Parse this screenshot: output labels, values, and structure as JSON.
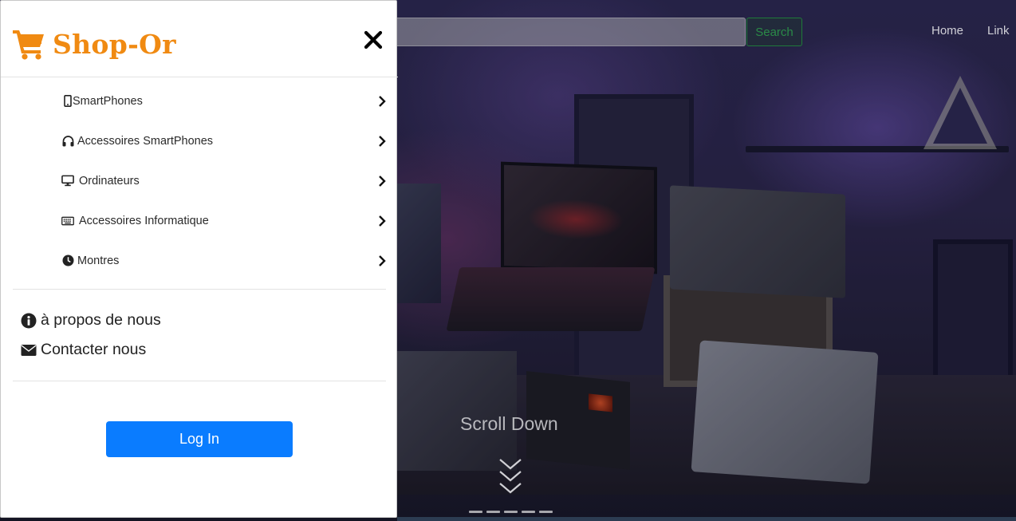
{
  "sidebar": {
    "brand": "Shop-Or",
    "categories": [
      {
        "label": "SmartPhones",
        "icon": "mobile-phone-icon"
      },
      {
        "label": "Accessoires SmartPhones",
        "icon": "headphones-icon"
      },
      {
        "label": "Ordinateurs",
        "icon": "desktop-monitor-icon"
      },
      {
        "label": "Accessoires Informatique",
        "icon": "keyboard-icon"
      },
      {
        "label": "Montres",
        "icon": "clock-icon"
      }
    ],
    "links": [
      {
        "label": "à propos de nous",
        "icon": "info-circle-icon"
      },
      {
        "label": "Contacter nous",
        "icon": "envelope-icon"
      }
    ],
    "login_label": "Log In"
  },
  "header": {
    "search_placeholder": "",
    "search_button": "Search",
    "nav": [
      "Home",
      "Link"
    ]
  },
  "hero": {
    "scroll_text": "Scroll Down"
  },
  "colors": {
    "brand": "#f08a12",
    "primary_button": "#0a7cff",
    "search_button_text": "#2a8a47"
  }
}
